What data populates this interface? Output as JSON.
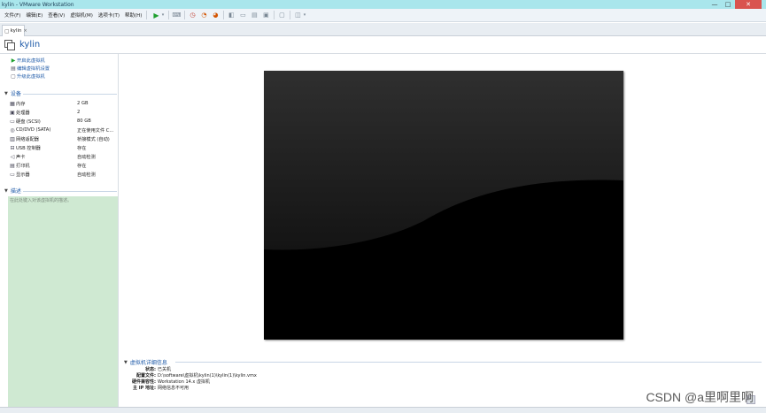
{
  "window": {
    "title": "kylin - VMware Workstation",
    "controls": {
      "minimize": "—",
      "maximize": "□",
      "close": "✕"
    }
  },
  "menu": [
    "文件(F)",
    "编辑(E)",
    "查看(V)",
    "虚拟机(M)",
    "选项卡(T)",
    "帮助(H)"
  ],
  "toolbar": {
    "icons": [
      "power-on-icon",
      "dropdown-icon",
      "send-keys-icon",
      "snapshot-icon",
      "revert-snapshot-icon",
      "manage-snapshots-icon",
      "library-view-icon",
      "thumbnail-view-icon",
      "tabs-view-icon",
      "fullscreen-icon",
      "console-icon",
      "unity-icon"
    ]
  },
  "tab": {
    "label": "kylin",
    "close": "×"
  },
  "vm": {
    "name": "kylin"
  },
  "commands": [
    {
      "label": "开启此虚拟机",
      "icon": "play-icon"
    },
    {
      "label": "编辑虚拟机设置",
      "icon": "settings-icon"
    },
    {
      "label": "升级此虚拟机",
      "icon": "upgrade-icon"
    }
  ],
  "devices_section": {
    "title": "设备"
  },
  "devices": [
    {
      "name": "内存",
      "value": "2 GB",
      "icon": "memory-icon"
    },
    {
      "name": "处理器",
      "value": "2",
      "icon": "cpu-icon"
    },
    {
      "name": "硬盘 (SCSI)",
      "value": "80 GB",
      "icon": "hdd-icon"
    },
    {
      "name": "CD/DVD (SATA)",
      "value": "正在使用文件 C...",
      "icon": "cdrom-icon"
    },
    {
      "name": "网络适配器",
      "value": "桥接模式 (自动)",
      "icon": "network-icon"
    },
    {
      "name": "USB 控制器",
      "value": "存在",
      "icon": "usb-icon"
    },
    {
      "name": "声卡",
      "value": "自动检测",
      "icon": "sound-icon"
    },
    {
      "name": "打印机",
      "value": "存在",
      "icon": "printer-icon"
    },
    {
      "name": "显示器",
      "value": "自动检测",
      "icon": "display-icon"
    }
  ],
  "description_section": {
    "title": "描述",
    "placeholder": "在此处键入对该虚拟机的描述。"
  },
  "details": {
    "title": "虚拟机详细信息",
    "rows": [
      {
        "label": "状态:",
        "value": "已关机"
      },
      {
        "label": "配置文件:",
        "value": "D:\\software\\虚拟机\\kylin(1)\\kylin(1)\\kylin.vmx"
      },
      {
        "label": "硬件兼容性:",
        "value": "Workstation 14.x 虚拟机"
      },
      {
        "label": "主 IP 地址:",
        "value": "网络信息不可用"
      }
    ]
  },
  "watermark": "CSDN @a里啊里啊",
  "colors": {
    "titlebar": "#a9e6ec",
    "link": "#1e5aa8",
    "description_bg": "#cfe9d2",
    "power_on": "#1fa02f"
  }
}
